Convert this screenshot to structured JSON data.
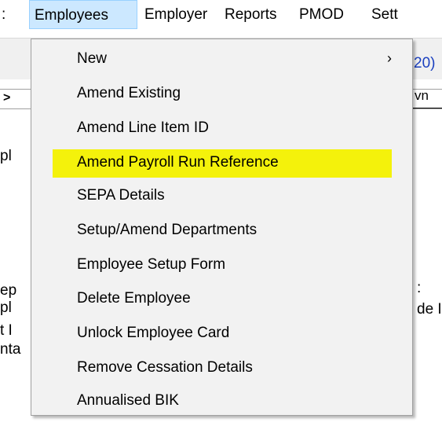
{
  "menubar": {
    "items": [
      {
        "label": ":"
      },
      {
        "label": "Employees"
      },
      {
        "label": "Employer"
      },
      {
        "label": "Reports"
      },
      {
        "label": "PMOD"
      },
      {
        "label": "Sett"
      }
    ]
  },
  "background": {
    "year_fragment": "20)",
    "tab_fragment": "vn",
    "row_fragments": [
      "pl",
      "ep",
      "pl",
      "t I",
      "nta"
    ],
    "right_fragments": [
      ":",
      "de I"
    ]
  },
  "dropdown": {
    "items": [
      {
        "label": "New",
        "submenu_icon": "›"
      },
      {
        "label": "Amend Existing"
      },
      {
        "label": "Amend Line Item ID"
      },
      {
        "label": "Amend Payroll Run Reference"
      },
      {
        "label": "SEPA Details"
      },
      {
        "label": "Setup/Amend Departments"
      },
      {
        "label": "Employee Setup Form"
      },
      {
        "label": "Delete Employee"
      },
      {
        "label": "Unlock Employee Card"
      },
      {
        "label": "Remove Cessation Details"
      },
      {
        "label": "Annualised BIK"
      }
    ]
  },
  "colors": {
    "highlight": "#f4f20b",
    "menu_active_bg": "#cce8ff",
    "menu_bg": "#f2f2f2"
  }
}
